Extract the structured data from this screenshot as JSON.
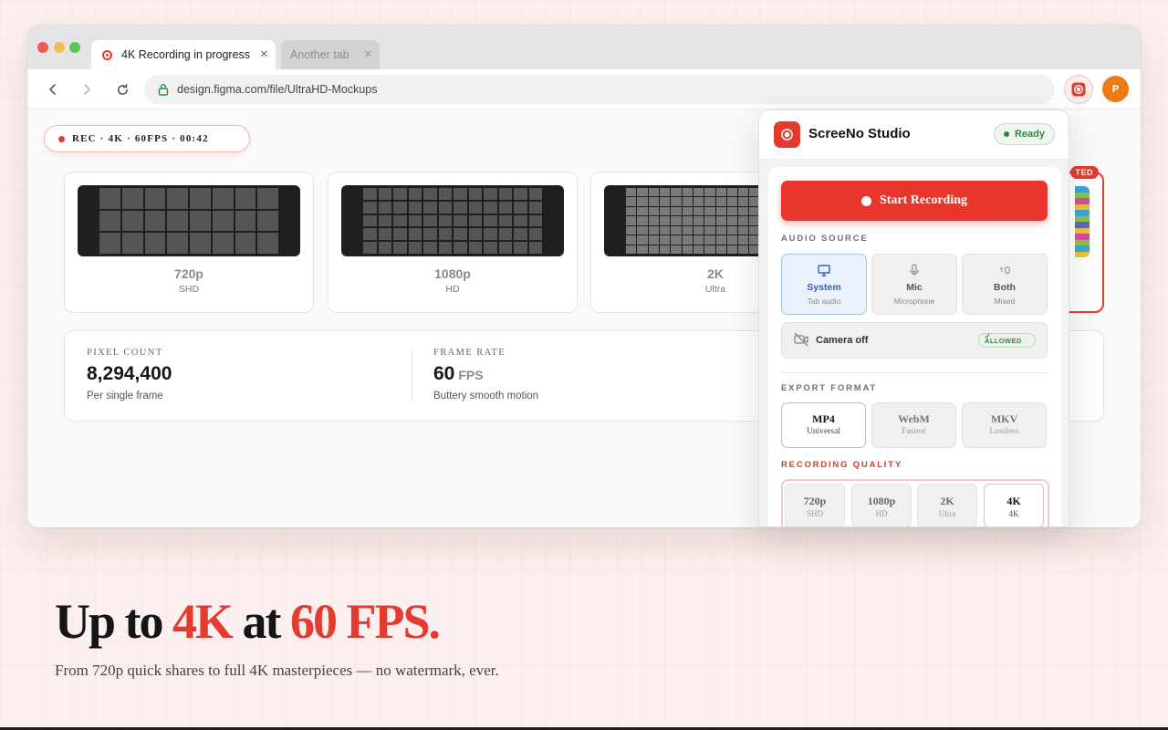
{
  "browser": {
    "tabs": [
      {
        "label": "4K Recording in progress",
        "close": "×"
      },
      {
        "label": "Another tab",
        "close": "×"
      }
    ],
    "url": "design.figma.com/file/UltraHD-Mockups",
    "avatar_initial": "P"
  },
  "page": {
    "rec_pill": "REC · 4K · 60FPS · 00:42",
    "resolution_cards": [
      {
        "name": "720p",
        "sub": "SHD"
      },
      {
        "name": "1080p",
        "sub": "HD"
      },
      {
        "name": "2K",
        "sub": "Ultra"
      }
    ],
    "selected_badge": "TED",
    "stats": [
      {
        "label": "PIXEL COUNT",
        "value": "8,294,400",
        "unit": "",
        "desc": "Per single frame"
      },
      {
        "label": "FRAME RATE",
        "value": "60",
        "unit": "FPS",
        "desc": "Buttery smooth motion"
      }
    ]
  },
  "panel": {
    "title": "ScreeNo Studio",
    "status": "Ready",
    "start_label": "Start Recording",
    "audio_label": "AUDIO SOURCE",
    "audio_options": [
      {
        "label": "System",
        "sub": "Tab audio",
        "icon": "monitor-icon"
      },
      {
        "label": "Mic",
        "sub": "Microphone",
        "icon": "microphone-icon"
      },
      {
        "label": "Both",
        "sub": "Mixed",
        "icon": "mixed-audio-icon"
      }
    ],
    "camera_label": "Camera off",
    "camera_permission": "ALLOWED",
    "camera_check": "✓",
    "export_label": "EXPORT FORMAT",
    "formats": [
      {
        "label": "MP4",
        "sub": "Universal"
      },
      {
        "label": "WebM",
        "sub": "Fastest"
      },
      {
        "label": "MKV",
        "sub": "Lossless"
      }
    ],
    "quality_label": "RECORDING QUALITY",
    "qualities": [
      {
        "label": "720p",
        "sub": "SHD"
      },
      {
        "label": "1080p",
        "sub": "HD"
      },
      {
        "label": "2K",
        "sub": "Ultra"
      },
      {
        "label": "4K",
        "sub": "4K"
      }
    ]
  },
  "hero": {
    "part1": "Up to ",
    "accent1": "4K",
    "part2": " at ",
    "accent2": "60 FPS.",
    "subtitle": "From 720p quick shares to full 4K masterpieces — no watermark, ever."
  },
  "colors": {
    "accent": "#e33b2f",
    "ready": "#2b8a47",
    "selected_blue": "#2a64c5"
  }
}
